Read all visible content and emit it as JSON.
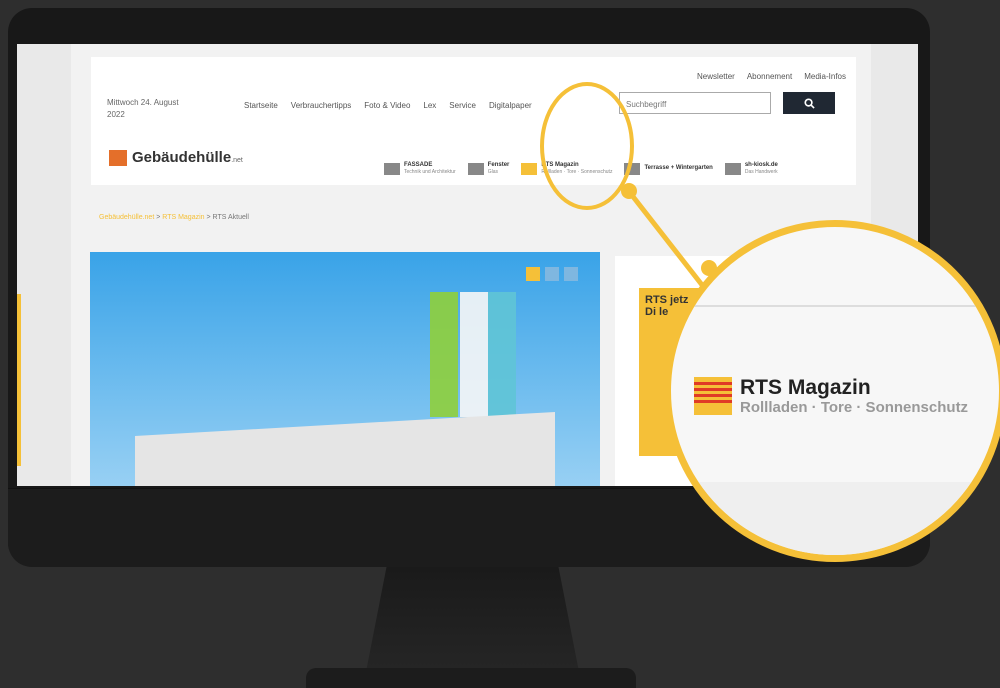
{
  "header": {
    "date": "Mittwoch 24. August 2022",
    "nav": [
      "Startseite",
      "Verbrauchertipps",
      "Foto & Video",
      "Lex",
      "Service",
      "Digitalpaper"
    ],
    "toplinks": [
      "Newsletter",
      "Abonnement",
      "Media-Infos"
    ],
    "search_placeholder": "Suchbegriff",
    "search_icon": "search-icon",
    "logo": "Gebäudehülle",
    "logo_suffix": ".net",
    "brands": [
      {
        "name": "FASSADE",
        "sub": "Technik und Architektur"
      },
      {
        "name": "Fenster",
        "sub": "Glas"
      },
      {
        "name": "RTS Magazin",
        "sub": "Rollladen · Tore · Sonnenschutz"
      },
      {
        "name": "Terrasse + Wintergarten",
        "sub": ""
      },
      {
        "name": "sh-kiosk.de",
        "sub": "Das Handwerk"
      }
    ]
  },
  "breadcrumb": {
    "home": "Gebäudehülle.net",
    "section": "RTS Magazin",
    "current": "RTS Aktuell"
  },
  "ad": {
    "text": "RTS jetz Di le"
  },
  "magnifier": {
    "title": "RTS Magazin",
    "subtitle": "Rollladen · Tore · Sonnenschutz"
  },
  "colors": {
    "accent": "#f5c038",
    "dark_button": "#202833"
  }
}
